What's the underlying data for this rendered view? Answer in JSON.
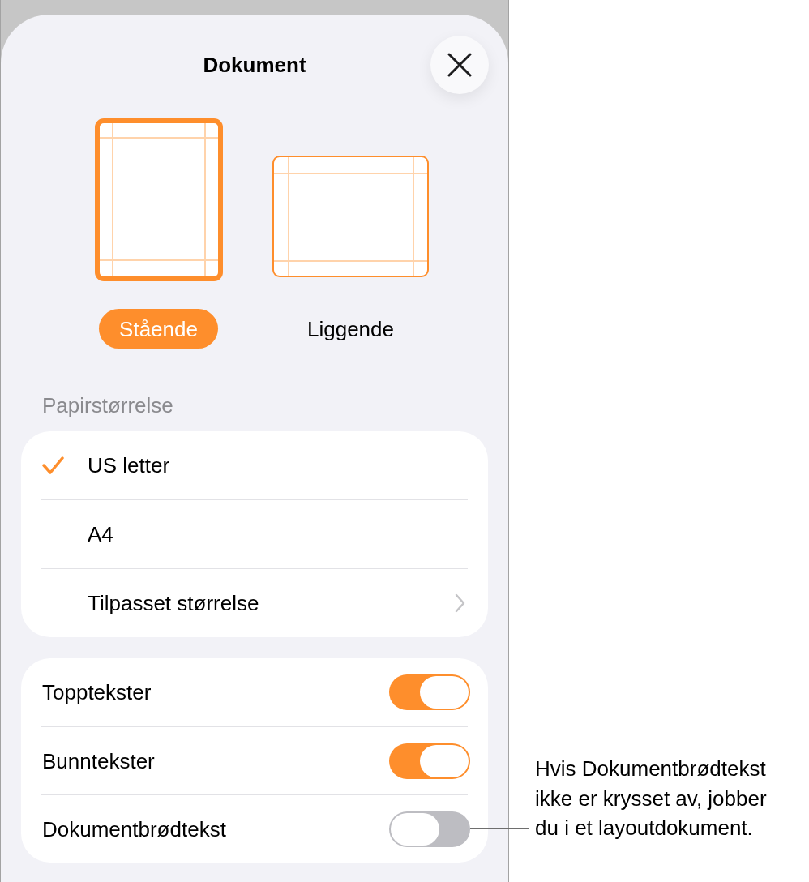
{
  "sheet": {
    "title": "Dokument"
  },
  "orientations": [
    {
      "kind": "portrait",
      "label": "Stående",
      "selected": true
    },
    {
      "kind": "landscape",
      "label": "Liggende",
      "selected": false
    }
  ],
  "paper_size": {
    "header": "Papirstørrelse",
    "options": [
      {
        "kind": "choice",
        "label": "US letter",
        "selected": true
      },
      {
        "kind": "choice",
        "label": "A4",
        "selected": false
      },
      {
        "kind": "submenu",
        "label": "Tilpasset størrelse",
        "selected": false
      }
    ]
  },
  "settings": [
    {
      "label": "Topptekster",
      "on": true
    },
    {
      "label": "Bunntekster",
      "on": true
    },
    {
      "label": "Dokumentbrødtekst",
      "on": false
    }
  ],
  "callout": {
    "text": "Hvis Dokumentbrødtekst ikke er krysset av, jobber du i et layoutdokument."
  }
}
